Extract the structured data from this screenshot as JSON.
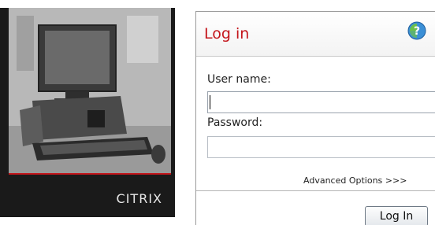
{
  "branding": {
    "logo_text": "CITRIX",
    "photo": "desktop-computer-photo",
    "accent_color": "#c4161c",
    "panel_color": "#1a1a1a"
  },
  "login": {
    "title": "Log in",
    "help_icon": "help-icon",
    "username_label": "User name:",
    "username_value": "",
    "password_label": "Password:",
    "password_value": "",
    "advanced_link": "Advanced Options >>>",
    "submit_label": "Log In",
    "title_color": "#c4161c"
  }
}
